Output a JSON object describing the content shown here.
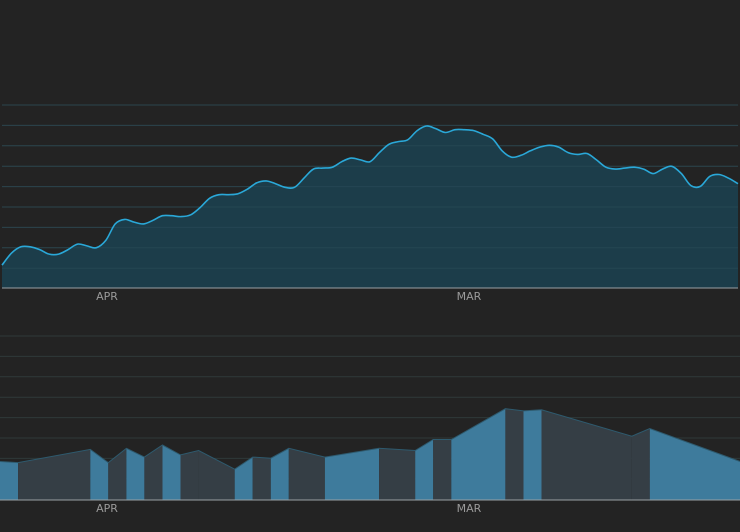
{
  "chart_data": [
    {
      "type": "area",
      "x_tick_labels": [
        "APR",
        "MAR"
      ],
      "grid": true,
      "ylim": [
        0,
        200
      ],
      "line_color": "#2aa8d8",
      "fill_color": "#1c3f4d",
      "grid_color": "#2f3a3a",
      "axis_color": "#9aa0a4",
      "series": [
        {
          "values": [
            25,
            38,
            45,
            45,
            42,
            37,
            37,
            42,
            48,
            46,
            44,
            52,
            70,
            75,
            72,
            70,
            74,
            79,
            79,
            78,
            80,
            88,
            98,
            102,
            102,
            103,
            108,
            115,
            117,
            114,
            110,
            110,
            120,
            130,
            131,
            132,
            138,
            142,
            140,
            138,
            148,
            157,
            160,
            162,
            172,
            177,
            174,
            170,
            173,
            173,
            172,
            168,
            163,
            150,
            143,
            145,
            150,
            154,
            156,
            154,
            148,
            146,
            147,
            140,
            132,
            130,
            131,
            132,
            130,
            125,
            130,
            133,
            125,
            112,
            111,
            122,
            124,
            120,
            114
          ]
        }
      ]
    },
    {
      "type": "area",
      "x_tick_labels": [
        "APR",
        "MAR"
      ],
      "grid": true,
      "ylim": [
        0,
        150
      ],
      "primary_color": "#3e7b9c",
      "secondary_color": "#353e45",
      "edge_color": "#2e5a6e",
      "grid_color": "#2f3a3a",
      "axis_color": "#9aa0a4",
      "series": [
        {
          "points": [
            [
              0,
              35
            ],
            [
              1,
              34
            ],
            [
              5,
              46
            ],
            [
              6,
              34
            ],
            [
              7,
              47
            ],
            [
              8,
              39
            ],
            [
              9,
              50
            ],
            [
              10,
              41
            ],
            [
              11,
              45
            ],
            [
              13,
              28
            ],
            [
              14,
              39
            ],
            [
              15,
              38
            ],
            [
              16,
              47
            ],
            [
              18,
              39
            ],
            [
              21,
              47
            ],
            [
              23,
              45
            ],
            [
              24,
              55
            ],
            [
              25,
              55
            ],
            [
              28,
              83
            ],
            [
              29,
              81
            ],
            [
              30,
              82
            ],
            [
              35,
              58
            ],
            [
              36,
              65
            ],
            [
              41,
              35
            ]
          ],
          "shading": [
            "A",
            "B",
            "A",
            "B",
            "A",
            "B",
            "A",
            "B",
            "B",
            "A",
            "B",
            "A",
            "B",
            "A",
            "B",
            "A",
            "B",
            "A",
            "B",
            "A",
            "B",
            "B",
            "A"
          ]
        }
      ]
    }
  ]
}
